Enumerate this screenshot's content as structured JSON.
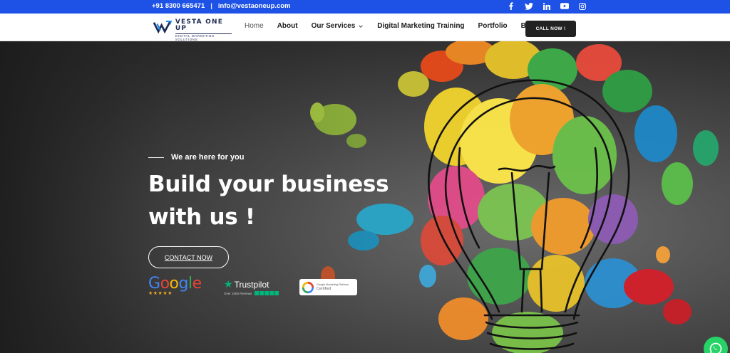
{
  "topbar": {
    "phone": "+91 8300 665471",
    "separator": "|",
    "email": "info@vestaoneup.com",
    "socials": [
      "facebook-icon",
      "twitter-icon",
      "linkedin-icon",
      "youtube-icon",
      "instagram-icon"
    ],
    "bg_color": "#1e52e6"
  },
  "nav": {
    "logo_main": "VESTA ONE UP",
    "logo_sub": "DIGITAL MARKETING SOLUTIONS",
    "items": [
      {
        "label": "Home"
      },
      {
        "label": "About"
      },
      {
        "label": "Our Services"
      },
      {
        "label": "Digital Marketing Training"
      },
      {
        "label": "Portfolio"
      },
      {
        "label": "Blog"
      }
    ],
    "call_label": "CALL NOW !"
  },
  "hero": {
    "eyebrow": "We are here for you",
    "headline_line1": "Build your business",
    "headline_line2": "with us !",
    "cta_label": "CONTACT NOW",
    "badges": {
      "google_word": "Google",
      "google_stars": "★★★★★",
      "trustpilot_title": "Trustpilot",
      "trustpilot_sub": "Over 1500 Reviews",
      "gmp_line1": "Google Marketing Platform",
      "gmp_line2": "Certified"
    }
  },
  "whatsapp_icon": "whatsapp-icon"
}
